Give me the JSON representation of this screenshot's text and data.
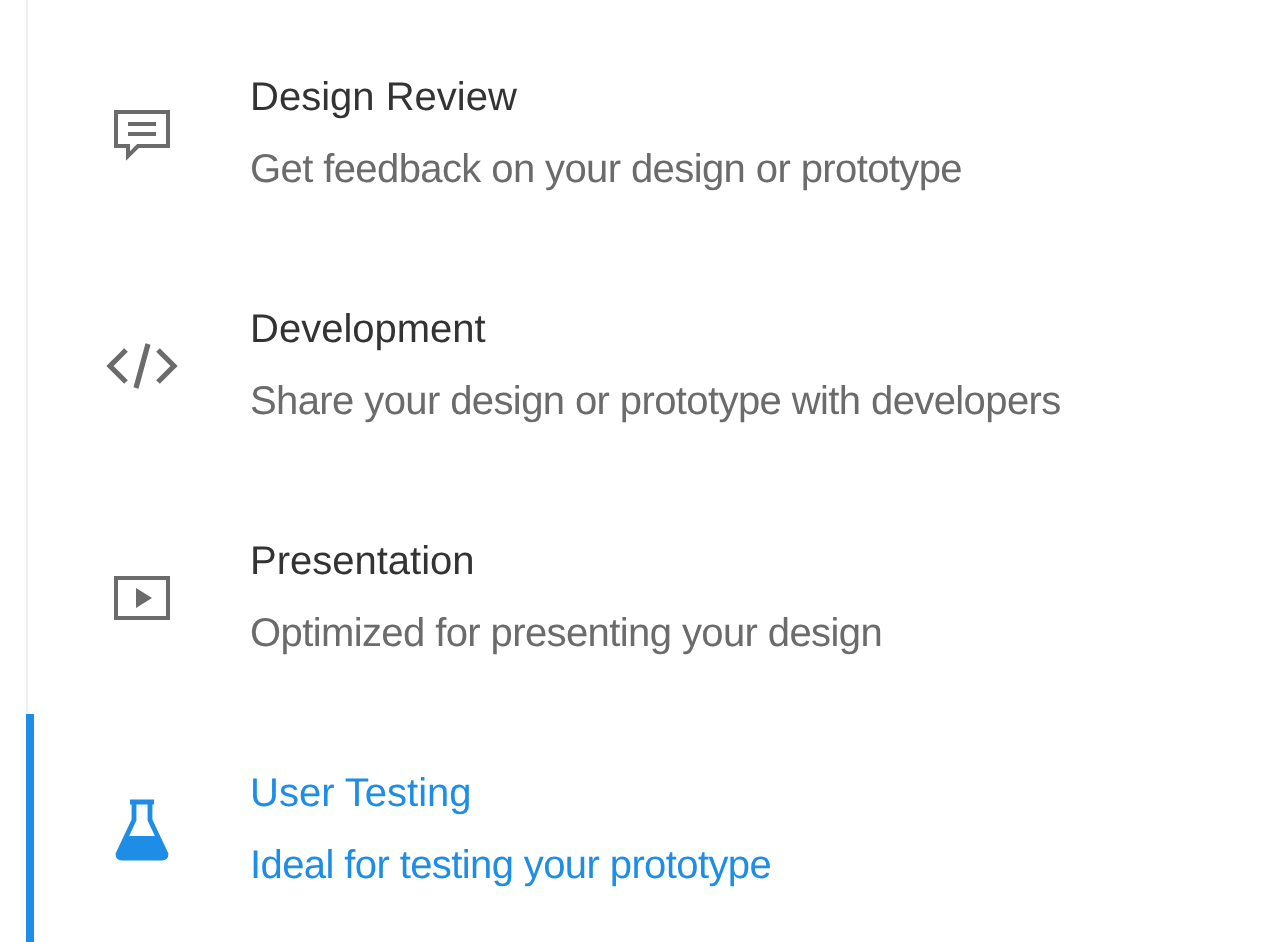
{
  "items": [
    {
      "kind": "comment",
      "title": "Design Review",
      "subtitle": "Get feedback on your design or prototype",
      "selected": false
    },
    {
      "kind": "code",
      "title": "Development",
      "subtitle": "Share your design or prototype with developers",
      "selected": false
    },
    {
      "kind": "play",
      "title": "Presentation",
      "subtitle": "Optimized for presenting your design",
      "selected": false
    },
    {
      "kind": "flask",
      "title": "User Testing",
      "subtitle": "Ideal for testing your prototype",
      "selected": true
    }
  ]
}
